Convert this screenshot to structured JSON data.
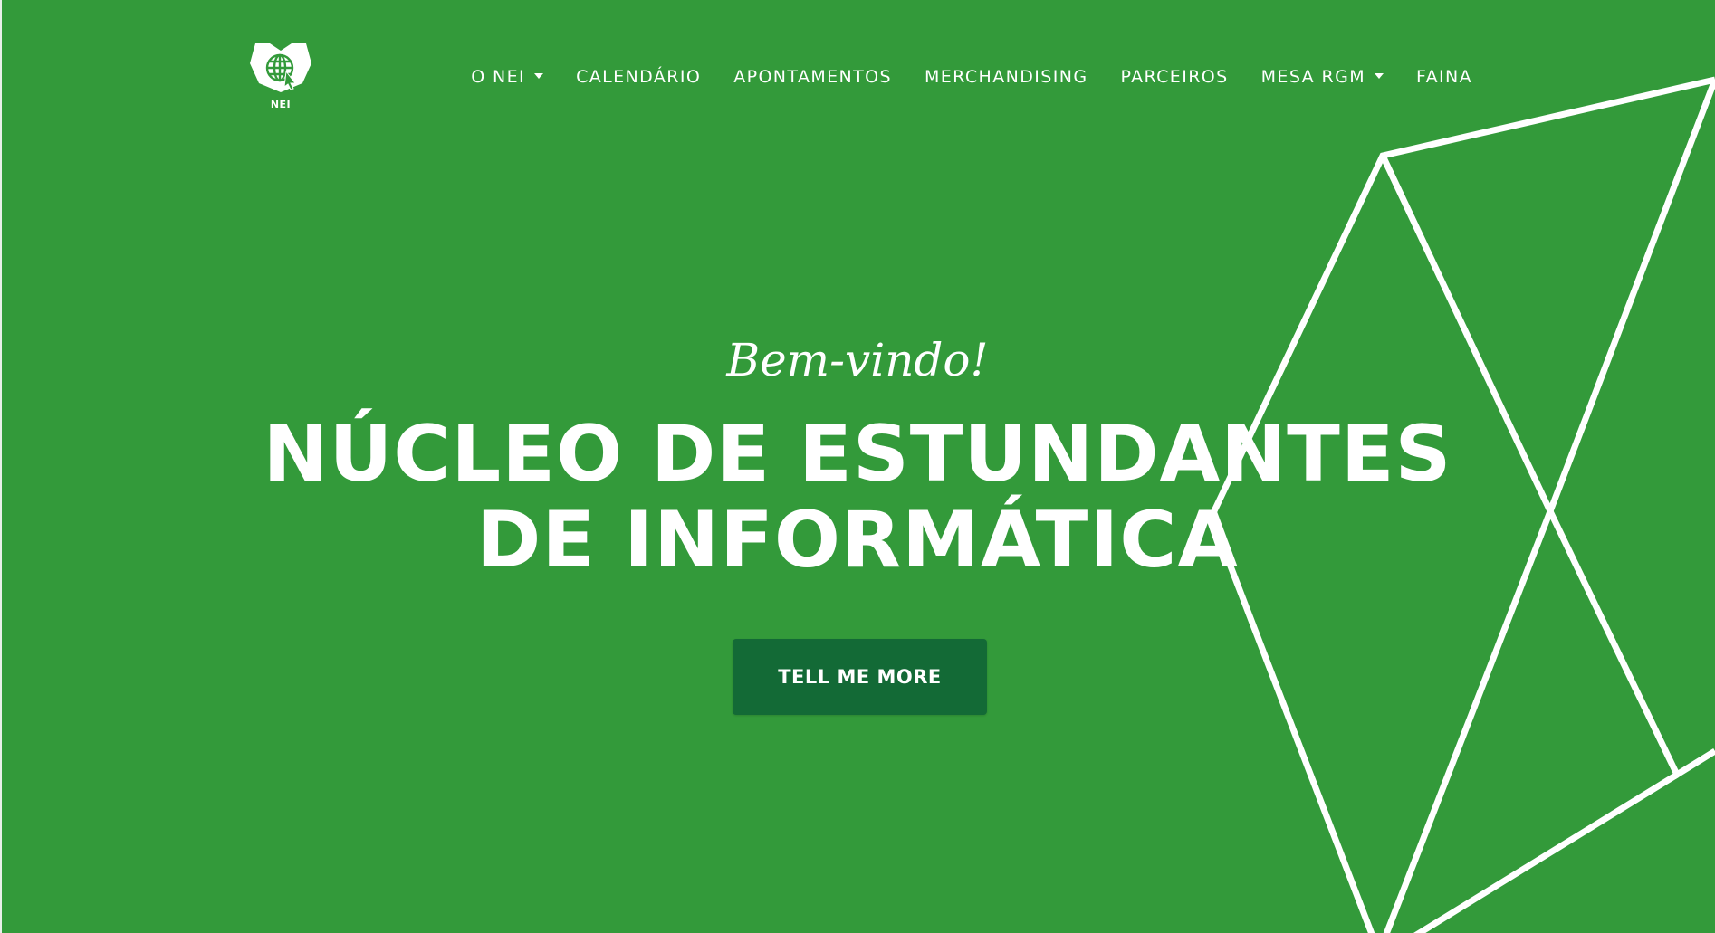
{
  "brand": {
    "logo_text": "NEI",
    "logo_icon": "globe-icon"
  },
  "nav": {
    "items": [
      {
        "label": "O NEI",
        "has_dropdown": true
      },
      {
        "label": "CALENDÁRIO",
        "has_dropdown": false
      },
      {
        "label": "APONTAMENTOS",
        "has_dropdown": false
      },
      {
        "label": "MERCHANDISING",
        "has_dropdown": false
      },
      {
        "label": "PARCEIROS",
        "has_dropdown": false
      },
      {
        "label": "MESA RGM",
        "has_dropdown": true
      },
      {
        "label": "FAINA",
        "has_dropdown": false
      }
    ]
  },
  "hero": {
    "subtitle": "Bem-vindo!",
    "title_line1": "NÚCLEO DE ESTUNDANTES",
    "title_line2": "DE INFORMÁTICA",
    "cta_label": "TELL ME MORE"
  },
  "colors": {
    "background": "#339a3a",
    "button": "#136a36",
    "text": "#ffffff"
  }
}
